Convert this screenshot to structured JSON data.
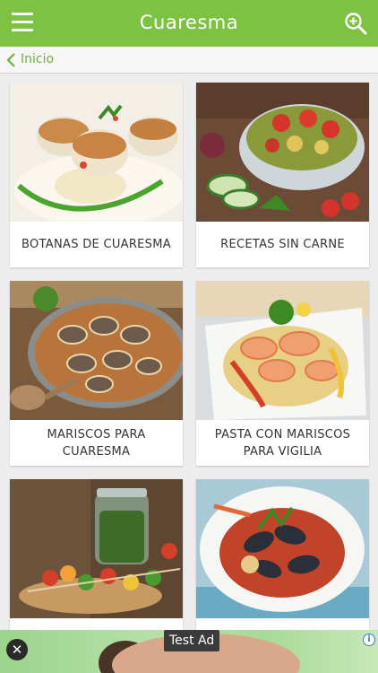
{
  "header": {
    "title": "Cuaresma",
    "menu_icon": "hamburger-menu-icon",
    "search_icon": "zoom-in-search-icon",
    "background_color": "#7dc242"
  },
  "breadcrumb": {
    "back_icon": "chevron-left-icon",
    "label": "Inicio",
    "color": "#6fb23a"
  },
  "categories": [
    {
      "label": "BOTANAS DE CUARESMA"
    },
    {
      "label": "RECETAS SIN CARNE"
    },
    {
      "label": "MARISCOS PARA CUARESMA"
    },
    {
      "label": "PASTA CON MARISCOS PARA VIGILIA"
    },
    {
      "label": ""
    },
    {
      "label": ""
    }
  ],
  "ad": {
    "label": "Test Ad",
    "close_icon": "close-icon",
    "info_icon": "info-icon"
  }
}
